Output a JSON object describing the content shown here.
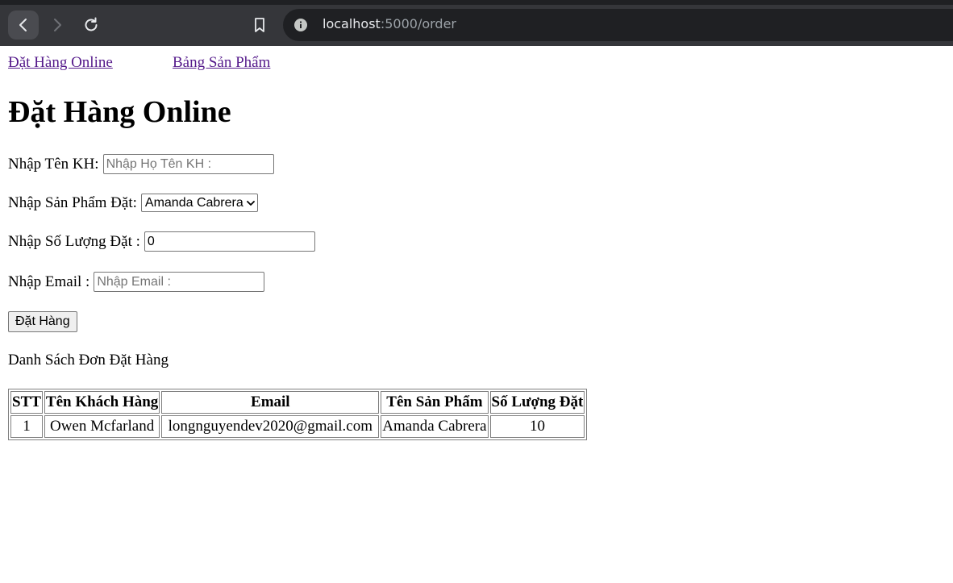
{
  "browser": {
    "url_host": "localhost",
    "url_path": ":5000/order"
  },
  "nav": {
    "link_order": "Đặt Hàng Online ",
    "link_products": "Bảng Sản Phẩm"
  },
  "page_title": "Đặt Hàng Online",
  "form": {
    "name_label": "Nhập Tên KH:",
    "name_placeholder": "Nhập Họ Tên KH :",
    "product_label": "Nhập Sản Phẩm Đặt:",
    "product_selected": "Amanda Cabrera",
    "quantity_label": "Nhập Số Lượng Đặt :",
    "quantity_value": "0",
    "email_label": "Nhập Email :",
    "email_placeholder": "Nhập Email :",
    "submit_label": "Đặt Hàng"
  },
  "orders": {
    "title": "Danh Sách Đơn Đặt Hàng",
    "headers": [
      "STT",
      "Tên Khách Hàng",
      "Email",
      "Tên Sản Phẩm",
      "Số Lượng Đặt"
    ],
    "rows": [
      [
        "1",
        "Owen Mcfarland",
        "longnguyendev2020@gmail.com",
        "Amanda Cabrera",
        "10"
      ]
    ]
  }
}
